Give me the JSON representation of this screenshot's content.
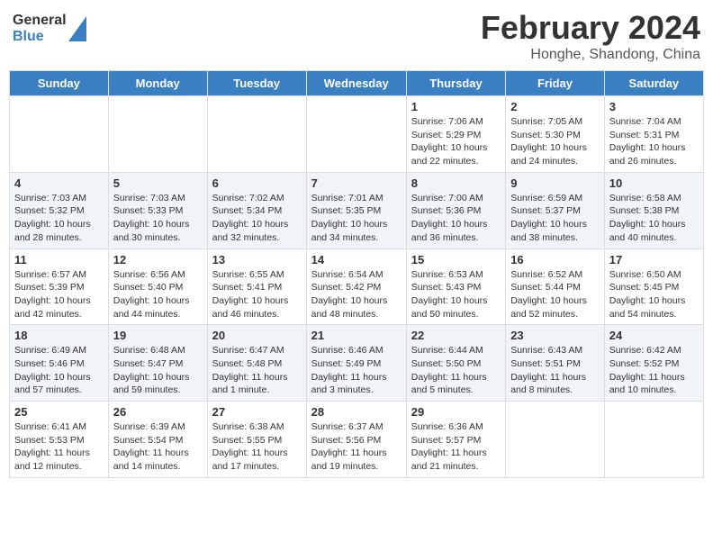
{
  "logo": {
    "general": "General",
    "blue": "Blue"
  },
  "header": {
    "title": "February 2024",
    "location": "Honghe, Shandong, China"
  },
  "days_of_week": [
    "Sunday",
    "Monday",
    "Tuesday",
    "Wednesday",
    "Thursday",
    "Friday",
    "Saturday"
  ],
  "weeks": [
    [
      {
        "day": "",
        "info": ""
      },
      {
        "day": "",
        "info": ""
      },
      {
        "day": "",
        "info": ""
      },
      {
        "day": "",
        "info": ""
      },
      {
        "day": "1",
        "info": "Sunrise: 7:06 AM\nSunset: 5:29 PM\nDaylight: 10 hours and 22 minutes."
      },
      {
        "day": "2",
        "info": "Sunrise: 7:05 AM\nSunset: 5:30 PM\nDaylight: 10 hours and 24 minutes."
      },
      {
        "day": "3",
        "info": "Sunrise: 7:04 AM\nSunset: 5:31 PM\nDaylight: 10 hours and 26 minutes."
      }
    ],
    [
      {
        "day": "4",
        "info": "Sunrise: 7:03 AM\nSunset: 5:32 PM\nDaylight: 10 hours and 28 minutes."
      },
      {
        "day": "5",
        "info": "Sunrise: 7:03 AM\nSunset: 5:33 PM\nDaylight: 10 hours and 30 minutes."
      },
      {
        "day": "6",
        "info": "Sunrise: 7:02 AM\nSunset: 5:34 PM\nDaylight: 10 hours and 32 minutes."
      },
      {
        "day": "7",
        "info": "Sunrise: 7:01 AM\nSunset: 5:35 PM\nDaylight: 10 hours and 34 minutes."
      },
      {
        "day": "8",
        "info": "Sunrise: 7:00 AM\nSunset: 5:36 PM\nDaylight: 10 hours and 36 minutes."
      },
      {
        "day": "9",
        "info": "Sunrise: 6:59 AM\nSunset: 5:37 PM\nDaylight: 10 hours and 38 minutes."
      },
      {
        "day": "10",
        "info": "Sunrise: 6:58 AM\nSunset: 5:38 PM\nDaylight: 10 hours and 40 minutes."
      }
    ],
    [
      {
        "day": "11",
        "info": "Sunrise: 6:57 AM\nSunset: 5:39 PM\nDaylight: 10 hours and 42 minutes."
      },
      {
        "day": "12",
        "info": "Sunrise: 6:56 AM\nSunset: 5:40 PM\nDaylight: 10 hours and 44 minutes."
      },
      {
        "day": "13",
        "info": "Sunrise: 6:55 AM\nSunset: 5:41 PM\nDaylight: 10 hours and 46 minutes."
      },
      {
        "day": "14",
        "info": "Sunrise: 6:54 AM\nSunset: 5:42 PM\nDaylight: 10 hours and 48 minutes."
      },
      {
        "day": "15",
        "info": "Sunrise: 6:53 AM\nSunset: 5:43 PM\nDaylight: 10 hours and 50 minutes."
      },
      {
        "day": "16",
        "info": "Sunrise: 6:52 AM\nSunset: 5:44 PM\nDaylight: 10 hours and 52 minutes."
      },
      {
        "day": "17",
        "info": "Sunrise: 6:50 AM\nSunset: 5:45 PM\nDaylight: 10 hours and 54 minutes."
      }
    ],
    [
      {
        "day": "18",
        "info": "Sunrise: 6:49 AM\nSunset: 5:46 PM\nDaylight: 10 hours and 57 minutes."
      },
      {
        "day": "19",
        "info": "Sunrise: 6:48 AM\nSunset: 5:47 PM\nDaylight: 10 hours and 59 minutes."
      },
      {
        "day": "20",
        "info": "Sunrise: 6:47 AM\nSunset: 5:48 PM\nDaylight: 11 hours and 1 minute."
      },
      {
        "day": "21",
        "info": "Sunrise: 6:46 AM\nSunset: 5:49 PM\nDaylight: 11 hours and 3 minutes."
      },
      {
        "day": "22",
        "info": "Sunrise: 6:44 AM\nSunset: 5:50 PM\nDaylight: 11 hours and 5 minutes."
      },
      {
        "day": "23",
        "info": "Sunrise: 6:43 AM\nSunset: 5:51 PM\nDaylight: 11 hours and 8 minutes."
      },
      {
        "day": "24",
        "info": "Sunrise: 6:42 AM\nSunset: 5:52 PM\nDaylight: 11 hours and 10 minutes."
      }
    ],
    [
      {
        "day": "25",
        "info": "Sunrise: 6:41 AM\nSunset: 5:53 PM\nDaylight: 11 hours and 12 minutes."
      },
      {
        "day": "26",
        "info": "Sunrise: 6:39 AM\nSunset: 5:54 PM\nDaylight: 11 hours and 14 minutes."
      },
      {
        "day": "27",
        "info": "Sunrise: 6:38 AM\nSunset: 5:55 PM\nDaylight: 11 hours and 17 minutes."
      },
      {
        "day": "28",
        "info": "Sunrise: 6:37 AM\nSunset: 5:56 PM\nDaylight: 11 hours and 19 minutes."
      },
      {
        "day": "29",
        "info": "Sunrise: 6:36 AM\nSunset: 5:57 PM\nDaylight: 11 hours and 21 minutes."
      },
      {
        "day": "",
        "info": ""
      },
      {
        "day": "",
        "info": ""
      }
    ]
  ]
}
